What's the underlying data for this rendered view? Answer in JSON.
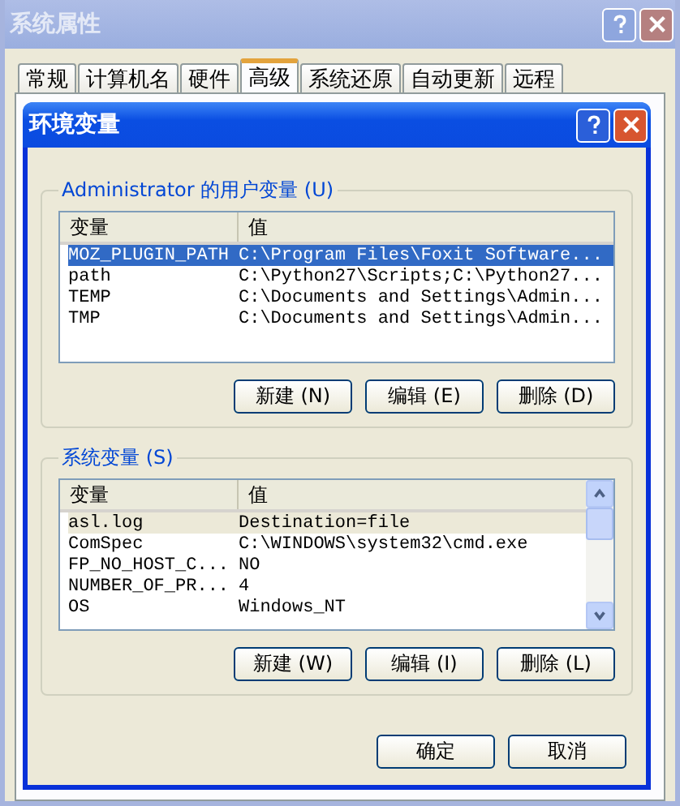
{
  "window": {
    "title": "系统属性",
    "active": false
  },
  "tabs": [
    {
      "label": "常规",
      "selected": false
    },
    {
      "label": "计算机名",
      "selected": false
    },
    {
      "label": "硬件",
      "selected": false
    },
    {
      "label": "高级",
      "selected": true
    },
    {
      "label": "系统还原",
      "selected": false
    },
    {
      "label": "自动更新",
      "selected": false
    },
    {
      "label": "远程",
      "selected": false
    }
  ],
  "dialog": {
    "title": "环境变量",
    "active": true
  },
  "groups": [
    {
      "title": "Administrator 的用户变量 (U)",
      "columns": [
        "变量",
        "值"
      ],
      "scrollbar": false,
      "focused": true,
      "rows": [
        {
          "name": "MOZ_PLUGIN_PATH",
          "value": "C:\\Program Files\\Foxit Software...",
          "selected": true
        },
        {
          "name": "path",
          "value": "C:\\Python27\\Scripts;C:\\Python27...",
          "selected": false
        },
        {
          "name": "TEMP",
          "value": "C:\\Documents and Settings\\Admin...",
          "selected": false
        },
        {
          "name": "TMP",
          "value": "C:\\Documents and Settings\\Admin...",
          "selected": false
        }
      ],
      "buttons": [
        "新建 (N)",
        "编辑 (E)",
        "删除 (D)"
      ]
    },
    {
      "title": "系统变量 (S)",
      "columns": [
        "变量",
        "值"
      ],
      "scrollbar": true,
      "focused": false,
      "rows": [
        {
          "name": "asl.log",
          "value": "Destination=file",
          "selected": true
        },
        {
          "name": "ComSpec",
          "value": "C:\\WINDOWS\\system32\\cmd.exe",
          "selected": false
        },
        {
          "name": "FP_NO_HOST_C...",
          "value": "NO",
          "selected": false
        },
        {
          "name": "NUMBER_OF_PR...",
          "value": "4",
          "selected": false
        },
        {
          "name": "OS",
          "value": "Windows_NT",
          "selected": false
        }
      ],
      "buttons": [
        "新建 (W)",
        "编辑 (I)",
        "删除 (L)"
      ]
    }
  ],
  "footer_buttons": [
    "确定",
    "取消"
  ]
}
